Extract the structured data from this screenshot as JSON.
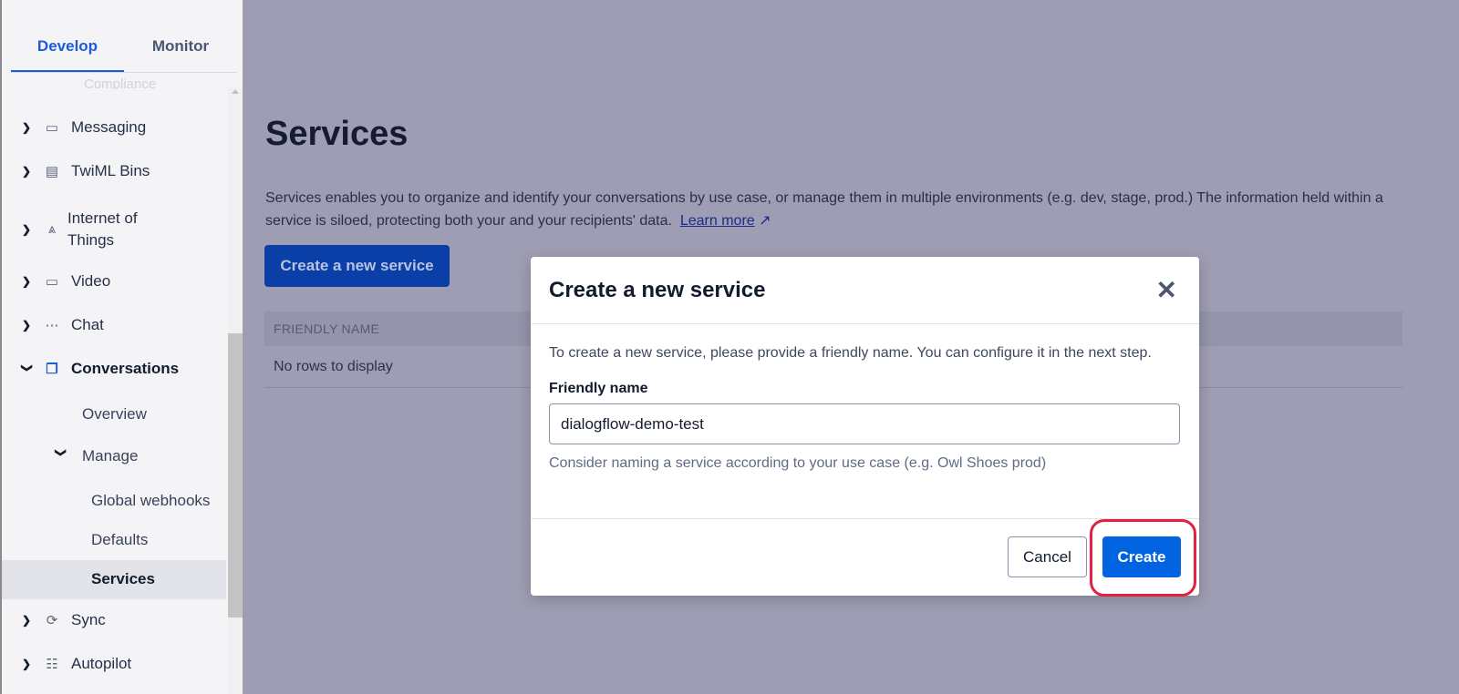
{
  "sidebar": {
    "tabs": [
      {
        "label": "Develop",
        "active": true
      },
      {
        "label": "Monitor",
        "active": false
      }
    ],
    "clipped_item": "Compliance",
    "items": [
      {
        "label": "Messaging",
        "icon": "chat-bubble-icon"
      },
      {
        "label": "TwiML Bins",
        "icon": "archive-box-icon"
      },
      {
        "label": "Internet of Things",
        "icon": "iot-nodes-icon"
      },
      {
        "label": "Video",
        "icon": "video-camera-icon"
      },
      {
        "label": "Chat",
        "icon": "chat-dots-icon"
      },
      {
        "label": "Conversations",
        "icon": "conversations-icon",
        "expanded": true
      },
      {
        "label": "Sync",
        "icon": "sync-icon"
      },
      {
        "label": "Autopilot",
        "icon": "robot-icon"
      }
    ],
    "conversations_sub": {
      "overview": "Overview",
      "manage": "Manage",
      "global_webhooks": "Global webhooks",
      "defaults": "Defaults",
      "services": "Services"
    }
  },
  "main": {
    "title": "Services",
    "description": "Services enables you to organize and identify your conversations by use case, or manage them in multiple environments (e.g. dev, stage, prod.) The information held within a service is siloed, protecting both your and your recipients' data.",
    "learn_more": "Learn more",
    "create_button": "Create a new service",
    "table_header": "FRIENDLY NAME",
    "empty_text": "No rows to display"
  },
  "modal": {
    "title": "Create a new service",
    "body": "To create a new service, please provide a friendly name. You can configure it in the next step.",
    "field_label": "Friendly name",
    "field_value": "dialogflow-demo-test",
    "help": "Consider naming a service according to your use case (e.g. Owl Shoes prod)",
    "cancel": "Cancel",
    "create": "Create"
  },
  "colors": {
    "accent": "#0263e0",
    "highlight_ring": "#e0213f"
  }
}
